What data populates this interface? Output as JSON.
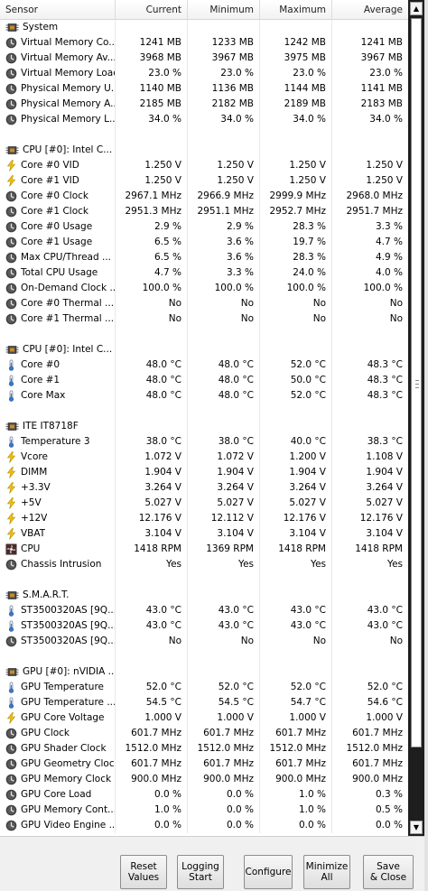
{
  "columns": [
    "Sensor",
    "Current",
    "Minimum",
    "Maximum",
    "Average"
  ],
  "rows": [
    {
      "type": "group",
      "icon": "chip-icon",
      "label": "System"
    },
    {
      "type": "sensor",
      "icon": "circle-icon",
      "label": "Virtual Memory Co...",
      "v": [
        "1241 MB",
        "1233 MB",
        "1242 MB",
        "1241 MB"
      ]
    },
    {
      "type": "sensor",
      "icon": "circle-icon",
      "label": "Virtual Memory Av...",
      "v": [
        "3968 MB",
        "3967 MB",
        "3975 MB",
        "3967 MB"
      ]
    },
    {
      "type": "sensor",
      "icon": "circle-icon",
      "label": "Virtual Memory Load",
      "v": [
        "23.0 %",
        "23.0 %",
        "23.0 %",
        "23.0 %"
      ]
    },
    {
      "type": "sensor",
      "icon": "circle-icon",
      "label": "Physical Memory U...",
      "v": [
        "1140 MB",
        "1136 MB",
        "1144 MB",
        "1141 MB"
      ]
    },
    {
      "type": "sensor",
      "icon": "circle-icon",
      "label": "Physical Memory A...",
      "v": [
        "2185 MB",
        "2182 MB",
        "2189 MB",
        "2183 MB"
      ]
    },
    {
      "type": "sensor",
      "icon": "circle-icon",
      "label": "Physical Memory L...",
      "v": [
        "34.0 %",
        "34.0 %",
        "34.0 %",
        "34.0 %"
      ]
    },
    {
      "type": "blank"
    },
    {
      "type": "group",
      "icon": "chip-icon",
      "label": "CPU [#0]: Intel C..."
    },
    {
      "type": "sensor",
      "icon": "bolt-icon",
      "label": "Core #0 VID",
      "v": [
        "1.250 V",
        "1.250 V",
        "1.250 V",
        "1.250 V"
      ]
    },
    {
      "type": "sensor",
      "icon": "bolt-icon",
      "label": "Core #1 VID",
      "v": [
        "1.250 V",
        "1.250 V",
        "1.250 V",
        "1.250 V"
      ]
    },
    {
      "type": "sensor",
      "icon": "circle-icon",
      "label": "Core #0 Clock",
      "v": [
        "2967.1 MHz",
        "2966.9 MHz",
        "2999.9 MHz",
        "2968.0 MHz"
      ]
    },
    {
      "type": "sensor",
      "icon": "circle-icon",
      "label": "Core #1 Clock",
      "v": [
        "2951.3 MHz",
        "2951.1 MHz",
        "2952.7 MHz",
        "2951.7 MHz"
      ]
    },
    {
      "type": "sensor",
      "icon": "circle-icon",
      "label": "Core #0 Usage",
      "v": [
        "2.9 %",
        "2.9 %",
        "28.3 %",
        "3.3 %"
      ]
    },
    {
      "type": "sensor",
      "icon": "circle-icon",
      "label": "Core #1 Usage",
      "v": [
        "6.5 %",
        "3.6 %",
        "19.7 %",
        "4.7 %"
      ]
    },
    {
      "type": "sensor",
      "icon": "circle-icon",
      "label": "Max CPU/Thread ...",
      "v": [
        "6.5 %",
        "3.6 %",
        "28.3 %",
        "4.9 %"
      ]
    },
    {
      "type": "sensor",
      "icon": "circle-icon",
      "label": "Total CPU Usage",
      "v": [
        "4.7 %",
        "3.3 %",
        "24.0 %",
        "4.0 %"
      ]
    },
    {
      "type": "sensor",
      "icon": "circle-icon",
      "label": "On-Demand Clock ...",
      "v": [
        "100.0 %",
        "100.0 %",
        "100.0 %",
        "100.0 %"
      ]
    },
    {
      "type": "sensor",
      "icon": "circle-icon",
      "label": "Core #0 Thermal ...",
      "v": [
        "No",
        "No",
        "No",
        "No"
      ]
    },
    {
      "type": "sensor",
      "icon": "circle-icon",
      "label": "Core #1 Thermal ...",
      "v": [
        "No",
        "No",
        "No",
        "No"
      ]
    },
    {
      "type": "blank"
    },
    {
      "type": "group",
      "icon": "chip-icon",
      "label": "CPU [#0]: Intel C..."
    },
    {
      "type": "sensor",
      "icon": "thermometer-icon",
      "label": "Core #0",
      "v": [
        "48.0 °C",
        "48.0 °C",
        "52.0 °C",
        "48.3 °C"
      ]
    },
    {
      "type": "sensor",
      "icon": "thermometer-icon",
      "label": "Core #1",
      "v": [
        "48.0 °C",
        "48.0 °C",
        "50.0 °C",
        "48.3 °C"
      ]
    },
    {
      "type": "sensor",
      "icon": "thermometer-icon",
      "label": "Core Max",
      "v": [
        "48.0 °C",
        "48.0 °C",
        "52.0 °C",
        "48.3 °C"
      ]
    },
    {
      "type": "blank"
    },
    {
      "type": "group",
      "icon": "chip-icon",
      "label": "ITE IT8718F"
    },
    {
      "type": "sensor",
      "icon": "thermometer-icon",
      "label": "Temperature 3",
      "v": [
        "38.0 °C",
        "38.0 °C",
        "40.0 °C",
        "38.3 °C"
      ]
    },
    {
      "type": "sensor",
      "icon": "bolt-icon",
      "label": "Vcore",
      "v": [
        "1.072 V",
        "1.072 V",
        "1.200 V",
        "1.108 V"
      ]
    },
    {
      "type": "sensor",
      "icon": "bolt-icon",
      "label": "DIMM",
      "v": [
        "1.904 V",
        "1.904 V",
        "1.904 V",
        "1.904 V"
      ]
    },
    {
      "type": "sensor",
      "icon": "bolt-icon",
      "label": "+3.3V",
      "v": [
        "3.264 V",
        "3.264 V",
        "3.264 V",
        "3.264 V"
      ]
    },
    {
      "type": "sensor",
      "icon": "bolt-icon",
      "label": "+5V",
      "v": [
        "5.027 V",
        "5.027 V",
        "5.027 V",
        "5.027 V"
      ]
    },
    {
      "type": "sensor",
      "icon": "bolt-icon",
      "label": "+12V",
      "v": [
        "12.176 V",
        "12.112 V",
        "12.176 V",
        "12.176 V"
      ]
    },
    {
      "type": "sensor",
      "icon": "bolt-icon",
      "label": "VBAT",
      "v": [
        "3.104 V",
        "3.104 V",
        "3.104 V",
        "3.104 V"
      ]
    },
    {
      "type": "sensor",
      "icon": "fan-icon",
      "label": "CPU",
      "v": [
        "1418 RPM",
        "1369 RPM",
        "1418 RPM",
        "1418 RPM"
      ]
    },
    {
      "type": "sensor",
      "icon": "circle-icon",
      "label": "Chassis Intrusion",
      "v": [
        "Yes",
        "Yes",
        "Yes",
        "Yes"
      ]
    },
    {
      "type": "blank"
    },
    {
      "type": "group",
      "icon": "chip-icon",
      "label": "S.M.A.R.T."
    },
    {
      "type": "sensor",
      "icon": "thermometer-icon",
      "label": "ST3500320AS [9Q...",
      "v": [
        "43.0 °C",
        "43.0 °C",
        "43.0 °C",
        "43.0 °C"
      ]
    },
    {
      "type": "sensor",
      "icon": "thermometer-icon",
      "label": "ST3500320AS [9Q...",
      "v": [
        "43.0 °C",
        "43.0 °C",
        "43.0 °C",
        "43.0 °C"
      ]
    },
    {
      "type": "sensor",
      "icon": "circle-icon",
      "label": "ST3500320AS [9Q...",
      "v": [
        "No",
        "No",
        "No",
        "No"
      ]
    },
    {
      "type": "blank"
    },
    {
      "type": "group",
      "icon": "chip-icon",
      "label": "GPU [#0]: nVIDIA ..."
    },
    {
      "type": "sensor",
      "icon": "thermometer-icon",
      "label": "GPU Temperature",
      "v": [
        "52.0 °C",
        "52.0 °C",
        "52.0 °C",
        "52.0 °C"
      ]
    },
    {
      "type": "sensor",
      "icon": "thermometer-icon",
      "label": "GPU Temperature ...",
      "v": [
        "54.5 °C",
        "54.5 °C",
        "54.7 °C",
        "54.6 °C"
      ]
    },
    {
      "type": "sensor",
      "icon": "bolt-icon",
      "label": "GPU Core Voltage",
      "v": [
        "1.000 V",
        "1.000 V",
        "1.000 V",
        "1.000 V"
      ]
    },
    {
      "type": "sensor",
      "icon": "circle-icon",
      "label": "GPU Clock",
      "v": [
        "601.7 MHz",
        "601.7 MHz",
        "601.7 MHz",
        "601.7 MHz"
      ]
    },
    {
      "type": "sensor",
      "icon": "circle-icon",
      "label": "GPU Shader Clock",
      "v": [
        "1512.0 MHz",
        "1512.0 MHz",
        "1512.0 MHz",
        "1512.0 MHz"
      ]
    },
    {
      "type": "sensor",
      "icon": "circle-icon",
      "label": "GPU Geometry Clock",
      "v": [
        "601.7 MHz",
        "601.7 MHz",
        "601.7 MHz",
        "601.7 MHz"
      ]
    },
    {
      "type": "sensor",
      "icon": "circle-icon",
      "label": "GPU Memory Clock",
      "v": [
        "900.0 MHz",
        "900.0 MHz",
        "900.0 MHz",
        "900.0 MHz"
      ]
    },
    {
      "type": "sensor",
      "icon": "circle-icon",
      "label": "GPU Core Load",
      "v": [
        "0.0 %",
        "0.0 %",
        "1.0 %",
        "0.3 %"
      ]
    },
    {
      "type": "sensor",
      "icon": "circle-icon",
      "label": "GPU Memory Cont...",
      "v": [
        "1.0 %",
        "0.0 %",
        "1.0 %",
        "0.5 %"
      ]
    },
    {
      "type": "sensor",
      "icon": "circle-icon",
      "label": "GPU Video Engine ...",
      "v": [
        "0.0 %",
        "0.0 %",
        "0.0 %",
        "0.0 %"
      ]
    }
  ],
  "buttons": [
    {
      "name": "reset-values-button",
      "label": "Reset\nValues"
    },
    {
      "name": "logging-start-button",
      "label": "Logging\nStart"
    },
    {
      "name": "configure-button",
      "label": "Configure"
    },
    {
      "name": "minimize-all-button",
      "label": "Minimize\nAll"
    },
    {
      "name": "save-close-button",
      "label": "Save\n& Close"
    }
  ],
  "scrollbar": {
    "up_label": "▲",
    "down_label": "▼"
  },
  "colors": {
    "bolt": "#f2c200",
    "thermometer": "#3a78c8",
    "circle": "#444444",
    "background": "#ffffff",
    "scrollbar": "#1e1e1e"
  }
}
